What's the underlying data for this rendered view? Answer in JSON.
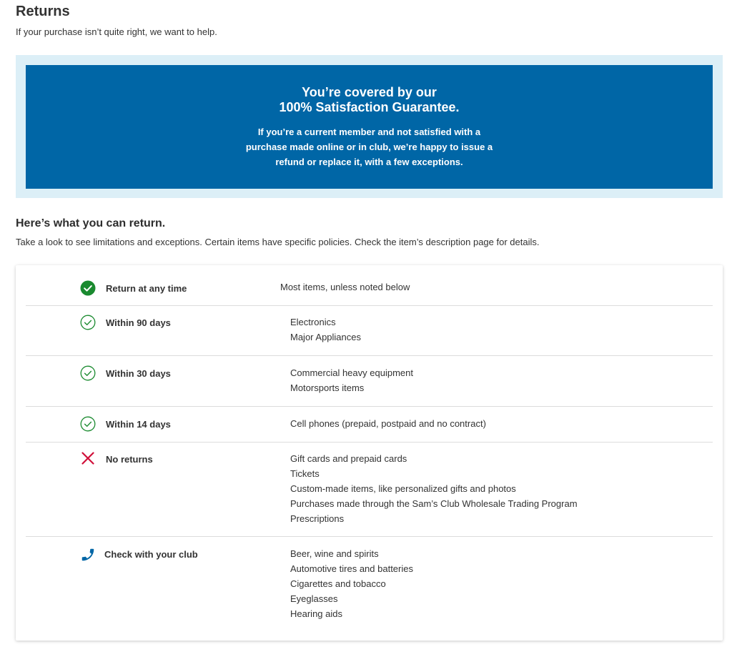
{
  "header": {
    "title": "Returns",
    "subtitle": "If your purchase isn’t quite right, we want to help."
  },
  "banner": {
    "heading_line1": "You’re covered by our",
    "heading_line2": "100% Satisfaction Guarantee.",
    "body_line1": "If you’re a current member and not satisfied with a",
    "body_line2": "purchase made online or in club, we’re happy to issue a",
    "body_line3": "refund or replace it, with a few exceptions.",
    "bg_color": "#0066a6",
    "outer_color": "#dcefF7"
  },
  "section": {
    "title": "Here’s what you can return.",
    "description": "Take a look to see limitations and exceptions. Certain items have specific policies. Check the item’s description page for details."
  },
  "return_policies": [
    {
      "icon": "check-circle-filled-icon",
      "label": "Return at any time",
      "items": [
        "Most items, unless noted below"
      ]
    },
    {
      "icon": "check-circle-outline-icon",
      "label": "Within 90 days",
      "items": [
        "Electronics",
        "Major Appliances"
      ]
    },
    {
      "icon": "check-circle-outline-icon",
      "label": "Within 30 days",
      "items": [
        "Commercial heavy equipment",
        "Motorsports items"
      ]
    },
    {
      "icon": "check-circle-outline-icon",
      "label": "Within 14 days",
      "items": [
        "Cell phones (prepaid, postpaid and no contract)"
      ]
    },
    {
      "icon": "x-icon",
      "label": "No returns",
      "items": [
        "Gift cards and prepaid cards",
        "Tickets",
        "Custom-made items, like personalized gifts and photos",
        "Purchases made through the Sam’s Club Wholesale Trading Program",
        "Prescriptions"
      ]
    },
    {
      "icon": "phone-icon",
      "label": "Check with your club",
      "items": [
        "Beer, wine and spirits",
        "Automotive tires and batteries",
        "Cigarettes and tobacco",
        "Eyeglasses",
        "Hearing aids"
      ]
    }
  ],
  "colors": {
    "check_green": "#1a8a2f",
    "x_red": "#d0103a",
    "phone_blue": "#0066a6"
  }
}
